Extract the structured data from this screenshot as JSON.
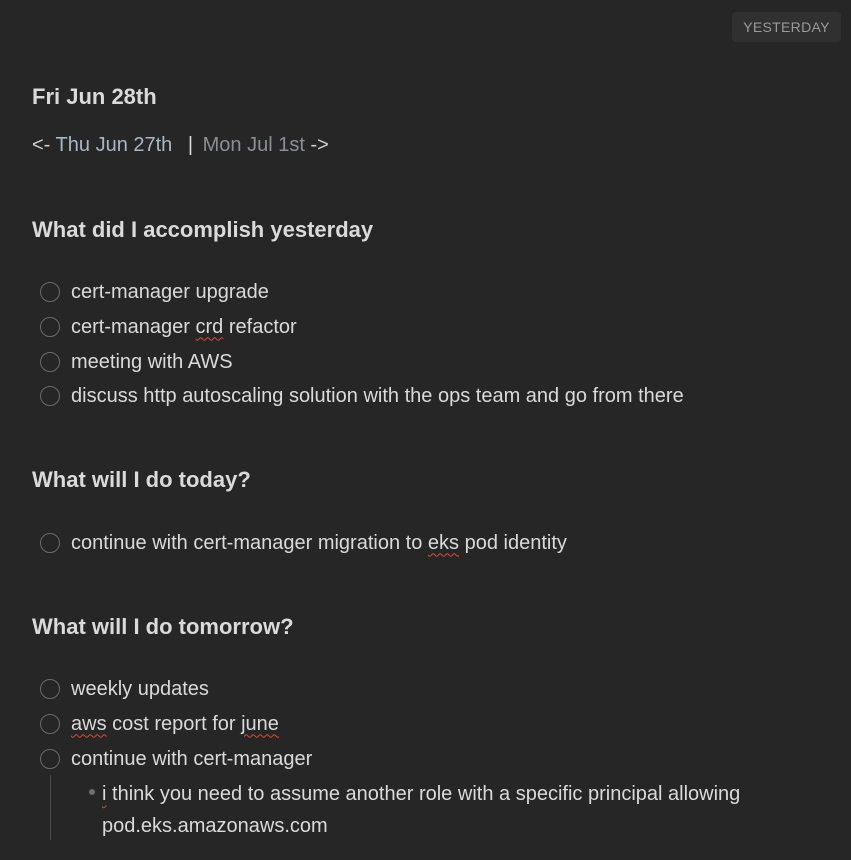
{
  "badge": {
    "label": "YESTERDAY"
  },
  "note_title": "Fri Jun 28th",
  "nav": {
    "prev_arrow": "<-",
    "prev_label": "Thu Jun 27th",
    "separator": "|",
    "next_label": "Mon Jul 1st",
    "next_arrow": "->"
  },
  "sections": [
    {
      "heading": "What did I accomplish yesterday",
      "tasks": [
        "cert-manager upgrade",
        "cert-manager crd refactor",
        "meeting with AWS",
        "discuss http autoscaling solution with the ops team and go from there"
      ]
    },
    {
      "heading": "What will I do today?",
      "tasks": [
        "continue with cert-manager migration to eks pod identity"
      ]
    },
    {
      "heading": "What will I do tomorrow?",
      "tasks": [
        "weekly updates",
        "aws cost report for june",
        "continue with cert-manager"
      ]
    }
  ],
  "sub_note": "i think you need to assume another role with a specific principal allowing pod.eks.amazonaws.com",
  "spelling_flags": [
    "crd",
    "eks",
    "aws",
    "june",
    "i"
  ]
}
